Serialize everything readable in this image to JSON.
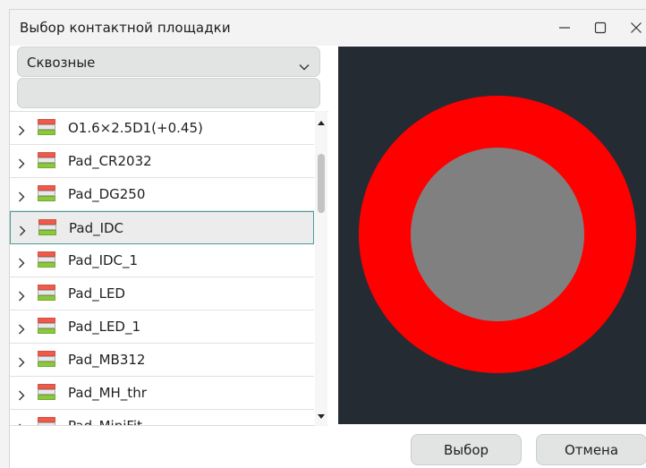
{
  "window": {
    "title": "Выбор контактной площадки",
    "controls": [
      "minimize-icon",
      "maximize-icon",
      "close-icon"
    ]
  },
  "pad_type_select": {
    "value": "Сквозные"
  },
  "filter_input": {
    "value": ""
  },
  "pad_list": {
    "selected_index": 3,
    "items": [
      {
        "label": "O1.6×2.5D1(+0.45)",
        "icon": "pad-stack-icon"
      },
      {
        "label": "Pad_CR2032",
        "icon": "pad-stack-icon"
      },
      {
        "label": "Pad_DG250",
        "icon": "pad-stack-icon"
      },
      {
        "label": "Pad_IDC",
        "icon": "pad-stack-icon"
      },
      {
        "label": "Pad_IDC_1",
        "icon": "pad-stack-icon"
      },
      {
        "label": "Pad_LED",
        "icon": "pad-stack-icon"
      },
      {
        "label": "Pad_LED_1",
        "icon": "pad-stack-icon"
      },
      {
        "label": "Pad_MB312",
        "icon": "pad-stack-icon"
      },
      {
        "label": "Pad_MH_thr",
        "icon": "pad-stack-icon"
      },
      {
        "label": "Pad_MiniFit",
        "icon": "pad-stack-icon"
      }
    ]
  },
  "preview": {
    "background": "#252b33",
    "pad_color": "#ff0000",
    "hole_color": "#808080"
  },
  "buttons": {
    "ok_label": "Выбор",
    "cancel_label": "Отмена"
  }
}
